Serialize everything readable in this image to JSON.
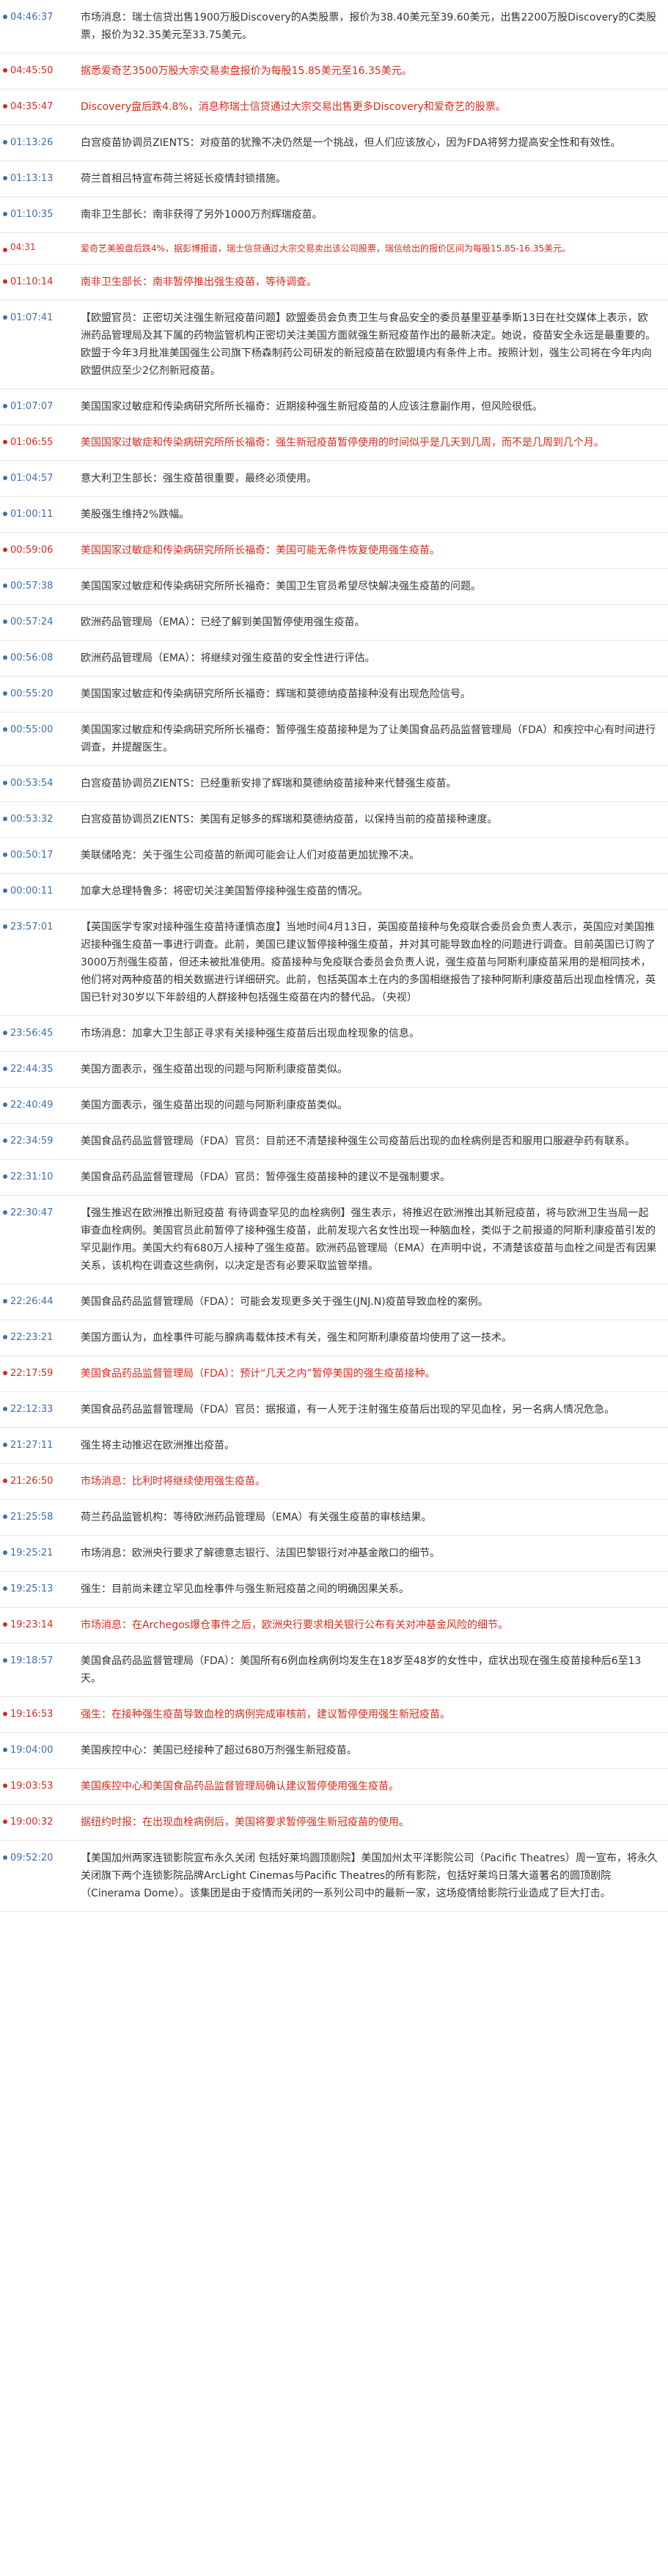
{
  "colors": {
    "normal_time": "#3a6fb5",
    "highlight": "#d52b1e",
    "text": "#333333"
  },
  "feed": [
    {
      "time": "04:46:37",
      "red": false,
      "text": "市场消息：瑞士信贷出售1900万股Discovery的A类股票，报价为38.40美元至39.60美元，出售2200万股Discovery的C类股票，报价为32.35美元至33.75美元。"
    },
    {
      "time": "04:45:50",
      "red": true,
      "text": "据悉爱奇艺3500万股大宗交易卖盘报价为每股15.85美元至16.35美元。"
    },
    {
      "time": "04:35:47",
      "red": true,
      "text": "Discovery盘后跌4.8%，消息称瑞士信贷通过大宗交易出售更多Discovery和爱奇艺的股票。"
    },
    {
      "time": "01:13:26",
      "red": false,
      "text": "白宫疫苗协调员ZIENTS：对疫苗的犹豫不决仍然是一个挑战，但人们应该放心，因为FDA将努力提高安全性和有效性。"
    },
    {
      "time": "01:13:13",
      "red": false,
      "text": "荷兰首相吕特宣布荷兰将延长疫情封锁措施。"
    },
    {
      "time": "01:10:35",
      "red": false,
      "text": "南非卫生部长：南非获得了另外1000万剂辉瑞疫苗。"
    },
    {
      "time": "04:31",
      "red": true,
      "small": true,
      "text": "爱奇艺美股盘后跌4%，据彭博报道，瑞士信贷通过大宗交易卖出该公司股票，瑞信给出的报价区间为每股15.85-16.35美元。"
    },
    {
      "time": "01:10:14",
      "red": true,
      "text": "南非卫生部长：南非暂停推出强生疫苗，等待调查。"
    },
    {
      "time": "01:07:41",
      "red": false,
      "text": "【欧盟官员：正密切关注强生新冠疫苗问题】欧盟委员会负责卫生与食品安全的委员基里亚基季斯13日在社交媒体上表示，欧洲药品管理局及其下属的药物监管机构正密切关注美国方面就强生新冠疫苗作出的最新决定。她说，疫苗安全永远是最重要的。欧盟于今年3月批准美国强生公司旗下杨森制药公司研发的新冠疫苗在欧盟境内有条件上市。按照计划，强生公司将在今年内向欧盟供应至少2亿剂新冠疫苗。"
    },
    {
      "time": "01:07:07",
      "red": false,
      "text": "美国国家过敏症和传染病研究所所长福奇：近期接种强生新冠疫苗的人应该注意副作用，但风险很低。"
    },
    {
      "time": "01:06:55",
      "red": true,
      "text": "美国国家过敏症和传染病研究所所长福奇：强生新冠疫苗暂停使用的时间似乎是几天到几周，而不是几周到几个月。"
    },
    {
      "time": "01:04:57",
      "red": false,
      "text": "意大利卫生部长：强生疫苗很重要，最终必须使用。"
    },
    {
      "time": "01:00:11",
      "red": false,
      "text": "美股强生维持2%跌幅。"
    },
    {
      "time": "00:59:06",
      "red": true,
      "text": "美国国家过敏症和传染病研究所所长福奇：美国可能无条件恢复使用强生疫苗。"
    },
    {
      "time": "00:57:38",
      "red": false,
      "text": "美国国家过敏症和传染病研究所所长福奇：美国卫生官员希望尽快解决强生疫苗的问题。"
    },
    {
      "time": "00:57:24",
      "red": false,
      "text": "欧洲药品管理局（EMA）：已经了解到美国暂停使用强生疫苗。"
    },
    {
      "time": "00:56:08",
      "red": false,
      "text": "欧洲药品管理局（EMA）：将继续对强生疫苗的安全性进行评估。"
    },
    {
      "time": "00:55:20",
      "red": false,
      "text": "美国国家过敏症和传染病研究所所长福奇：辉瑞和莫德纳疫苗接种没有出现危险信号。"
    },
    {
      "time": "00:55:00",
      "red": false,
      "text": "美国国家过敏症和传染病研究所所长福奇：暂停强生疫苗接种是为了让美国食品药品监督管理局（FDA）和疾控中心有时间进行调查，并提醒医生。"
    },
    {
      "time": "00:53:54",
      "red": false,
      "text": "白宫疫苗协调员ZIENTS：已经重新安排了辉瑞和莫德纳疫苗接种来代替强生疫苗。"
    },
    {
      "time": "00:53:32",
      "red": false,
      "text": "白宫疫苗协调员ZIENTS：美国有足够多的辉瑞和莫德纳疫苗，以保持当前的疫苗接种速度。"
    },
    {
      "time": "00:50:17",
      "red": false,
      "text": "美联储哈克：关于强生公司疫苗的新闻可能会让人们对疫苗更加犹豫不决。"
    },
    {
      "time": "00:00:11",
      "red": false,
      "text": "加拿大总理特鲁多：将密切关注美国暂停接种强生疫苗的情况。"
    },
    {
      "time": "23:57:01",
      "red": false,
      "text": "【英国医学专家对接种强生疫苗持谨慎态度】当地时间4月13日，英国疫苗接种与免疫联合委员会负责人表示，英国应对美国推迟接种强生疫苗一事进行调查。此前，美国已建议暂停接种强生疫苗，并对其可能导致血栓的问题进行调查。目前英国已订购了3000万剂强生疫苗，但还未被批准使用。疫苗接种与免疫联合委员会负责人说，强生疫苗与阿斯利康疫苗采用的是相同技术，他们将对两种疫苗的相关数据进行详细研究。此前，包括英国本土在内的多国相继报告了接种阿斯利康疫苗后出现血栓情况，英国已针对30岁以下年龄组的人群接种包括强生疫苗在内的替代品。（央视）"
    },
    {
      "time": "23:56:45",
      "red": false,
      "text": "市场消息：加拿大卫生部正寻求有关接种强生疫苗后出现血栓现象的信息。"
    },
    {
      "time": "22:44:35",
      "red": false,
      "text": "美国方面表示，强生疫苗出现的问题与阿斯利康疫苗类似。"
    },
    {
      "time": "22:40:49",
      "red": false,
      "text": "美国方面表示，强生疫苗出现的问题与阿斯利康疫苗类似。"
    },
    {
      "time": "22:34:59",
      "red": false,
      "text": "美国食品药品监督管理局（FDA）官员：目前还不清楚接种强生公司疫苗后出现的血栓病例是否和服用口服避孕药有联系。"
    },
    {
      "time": "22:31:10",
      "red": false,
      "text": "美国食品药品监督管理局（FDA）官员：暂停强生疫苗接种的建议不是强制要求。"
    },
    {
      "time": "22:30:47",
      "red": false,
      "text": "【强生推迟在欧洲推出新冠疫苗 有待调查罕见的血栓病例】强生表示，将推迟在欧洲推出其新冠疫苗，将与欧洲卫生当局一起审查血栓病例。美国官员此前暂停了接种强生疫苗，此前发现六名女性出现一种脑血栓，类似于之前报道的阿斯利康疫苗引发的罕见副作用。美国大约有680万人接种了强生疫苗。欧洲药品管理局（EMA）在声明中说，不清楚该疫苗与血栓之间是否有因果关系，该机构在调查这些病例，以决定是否有必要采取监管举措。"
    },
    {
      "time": "22:26:44",
      "red": false,
      "text": "美国食品药品监督管理局（FDA）：可能会发现更多关于强生(JNJ.N)疫苗导致血栓的案例。"
    },
    {
      "time": "22:23:21",
      "red": false,
      "text": "美国方面认为，血栓事件可能与腺病毒载体技术有关，强生和阿斯利康疫苗均使用了这一技术。"
    },
    {
      "time": "22:17:59",
      "red": true,
      "text": "美国食品药品监督管理局（FDA）：预计“几天之内”暂停美国的强生疫苗接种。"
    },
    {
      "time": "22:12:33",
      "red": false,
      "text": "美国食品药品监督管理局（FDA）官员：据报道，有一人死于注射强生疫苗后出现的罕见血栓，另一名病人情况危急。"
    },
    {
      "time": "21:27:11",
      "red": false,
      "text": "强生将主动推迟在欧洲推出疫苗。"
    },
    {
      "time": "21:26:50",
      "red": true,
      "text": "市场消息：比利时将继续使用强生疫苗。"
    },
    {
      "time": "21:25:58",
      "red": false,
      "text": "荷兰药品监管机构：等待欧洲药品管理局（EMA）有关强生疫苗的审核结果。"
    },
    {
      "time": "19:25:21",
      "red": false,
      "text": "市场消息：欧洲央行要求了解德意志银行、法国巴黎银行对冲基金敞口的细节。"
    },
    {
      "time": "19:25:13",
      "red": false,
      "text": "强生：目前尚未建立罕见血栓事件与强生新冠疫苗之间的明确因果关系。"
    },
    {
      "time": "19:23:14",
      "red": true,
      "text": "市场消息：在Archegos爆仓事件之后，欧洲央行要求相关银行公布有关对冲基金风险的细节。"
    },
    {
      "time": "19:18:57",
      "red": false,
      "text": "美国食品药品监督管理局（FDA）：美国所有6例血栓病例均发生在18岁至48岁的女性中，症状出现在强生疫苗接种后6至13天。"
    },
    {
      "time": "19:16:53",
      "red": true,
      "text": "强生：在接种强生疫苗导致血栓的病例完成审核前，建议暂停使用强生新冠疫苗。"
    },
    {
      "time": "19:04:00",
      "red": false,
      "text": "美国疾控中心：美国已经接种了超过680万剂强生新冠疫苗。"
    },
    {
      "time": "19:03:53",
      "red": true,
      "text": "美国疾控中心和美国食品药品监督管理局确认建议暂停使用强生疫苗。"
    },
    {
      "time": "19:00:32",
      "red": true,
      "text": "据纽约时报：在出现血栓病例后，美国将要求暂停强生新冠疫苗的使用。"
    },
    {
      "time": "09:52:20",
      "red": false,
      "text": "【美国加州两家连锁影院宣布永久关闭 包括好莱坞圆顶剧院】美国加州太平洋影院公司（Pacific Theatres）周一宣布，将永久关闭旗下两个连锁影院品牌ArcLight Cinemas与Pacific Theatres的所有影院，包括好莱坞日落大道著名的圆顶剧院（Cinerama Dome）。该集团是由于疫情而关闭的一系列公司中的最新一家，这场疫情给影院行业造成了巨大打击。"
    }
  ]
}
